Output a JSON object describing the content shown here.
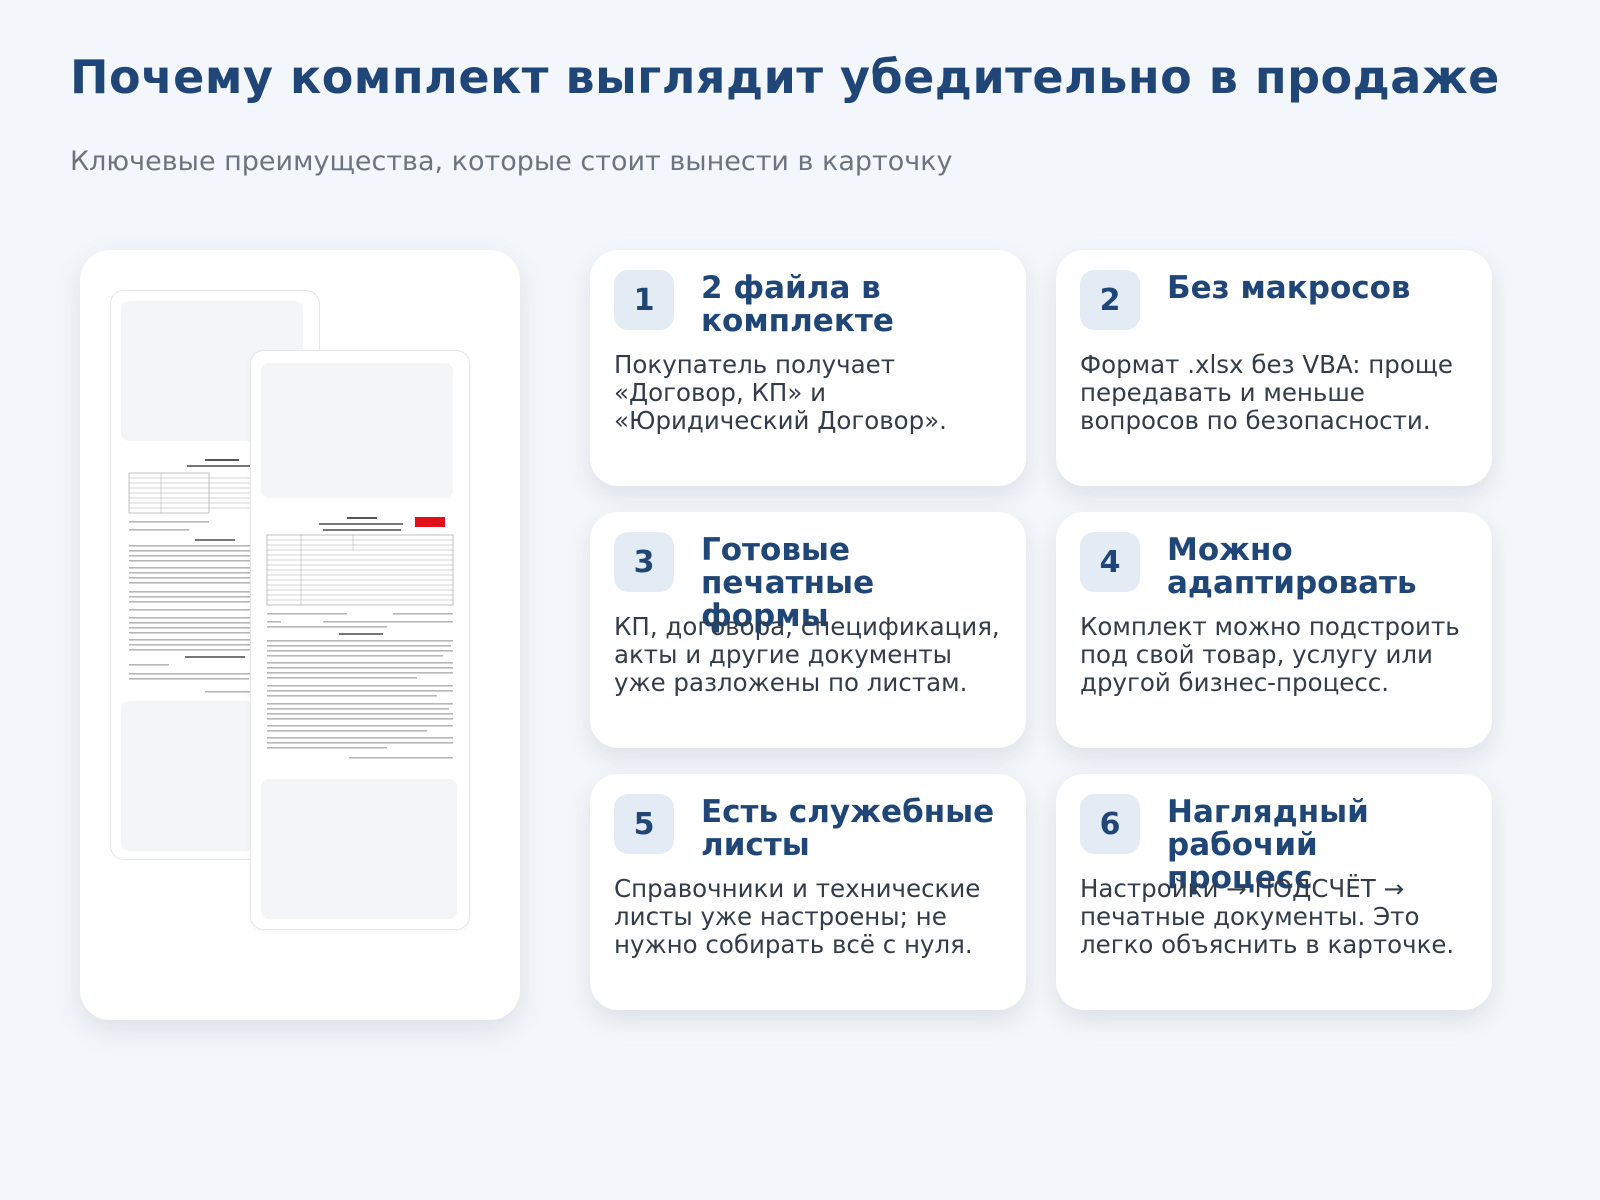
{
  "header": {
    "title": "Почему комплект выглядит убедительно в продаже",
    "subtitle": "Ключевые преимущества, которые стоит вынести в карточку"
  },
  "cards": [
    {
      "number": "1",
      "title": "2 файла в комплекте",
      "text": "Покупатель получает «Договор, КП» и «Юридический Договор»."
    },
    {
      "number": "2",
      "title": "Без макросов",
      "text": "Формат .xlsx без VBA: проще передавать и меньше вопросов по безопасности."
    },
    {
      "number": "3",
      "title": "Готовые печатные формы",
      "text": "КП, договора, спецификация, акты и другие документы уже разложены по листам."
    },
    {
      "number": "4",
      "title": "Можно адаптировать",
      "text": "Комплект можно подстроить под свой товар, услугу или другой бизнес-процесс."
    },
    {
      "number": "5",
      "title": "Есть служебные листы",
      "text": "Справочники и технические листы уже настроены; не нужно собирать всё с нуля."
    },
    {
      "number": "6",
      "title": "Наглядный рабочий процесс",
      "text": "Настройки → ПОДСЧЁТ → печатные документы. Это легко объяснить в карточке."
    }
  ],
  "colors": {
    "accent": "#1f4677",
    "badge_bg": "#e3ebf5",
    "background": "#f3f6fa",
    "doc_stamp": "#e0101a"
  }
}
